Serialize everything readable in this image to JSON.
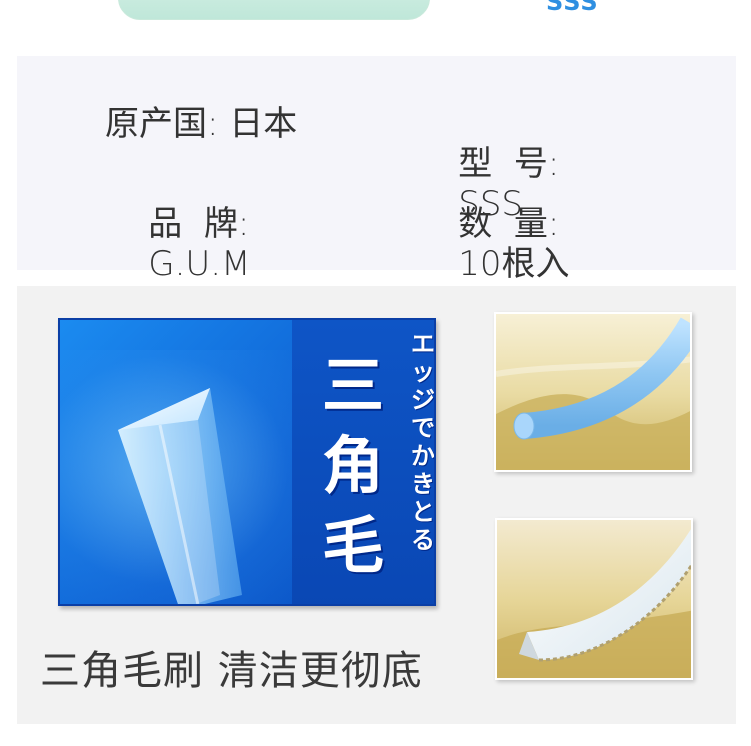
{
  "top": {
    "sss_label": "SSS"
  },
  "specs": {
    "origin": {
      "label": "原产国:",
      "value": "日本"
    },
    "model": {
      "label": "型  号:",
      "value": "SSS"
    },
    "brand": {
      "label": "品  牌:",
      "value": "G.U.M"
    },
    "quantity": {
      "label": "数  量:",
      "value": "10根入"
    }
  },
  "feature": {
    "tagline_small": "エッジでかきとる",
    "tagline_big": "三角毛",
    "caption": "三角毛刷 清洁更彻底"
  },
  "colors": {
    "accent_blue": "#2f8fe1",
    "card_blue": "#0e62d4",
    "mint": "#bfe7d9",
    "panel_bg": "#f5f5fa"
  },
  "icons": {
    "round_bristle": "round-bristle-illustration",
    "triangle_bristle": "triangle-bristle-illustration"
  }
}
